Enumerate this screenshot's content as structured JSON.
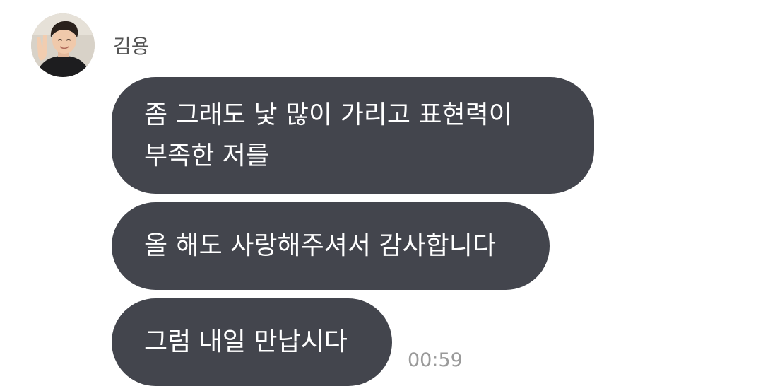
{
  "sender": {
    "name": "김용",
    "avatar_icon": "profile-photo"
  },
  "messages": [
    {
      "lines": [
        "좀 그래도 낯 많이 가리고 표현력이",
        "부족한 저를"
      ]
    },
    {
      "lines": [
        "올 해도 사랑해주셔서 감사합니다"
      ]
    },
    {
      "lines": [
        "그럼 내일 만납시다"
      ]
    }
  ],
  "timestamp": "00:59",
  "colors": {
    "bubble_bg": "#43454d",
    "bubble_text": "#ffffff",
    "name_text": "#555555",
    "time_text": "#9a9a9a"
  }
}
